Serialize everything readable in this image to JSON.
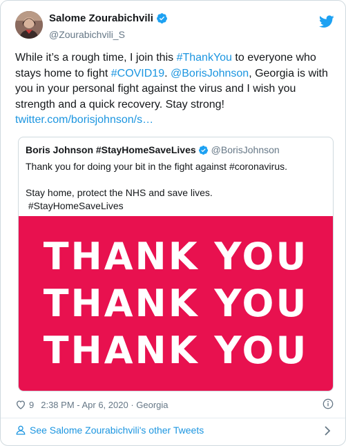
{
  "author": {
    "name": "Salome Zourabichvili",
    "handle": "@Zourabichvili_S"
  },
  "tweet": {
    "t1": "While it’s a rough time, I join this ",
    "hashtag1": "#ThankYou",
    "t2": " to everyone who stays home to fight ",
    "hashtag2": "#COVID19",
    "t3": ". ",
    "mention": "@BorisJohnson",
    "t4": ", Georgia is with you in your personal fight against the virus and I wish you strength and a quick recovery. Stay strong!",
    "link": "twitter.com/borisjohnson/s…"
  },
  "quoted": {
    "name": "Boris Johnson #StayHomeSaveLives",
    "handle": "@BorisJohnson",
    "line1": "Thank you for doing your bit in the fight against #coronavirus.",
    "line2": "Stay home, protect the NHS and save lives.",
    "line3": " #StayHomeSaveLives",
    "image_lines": [
      "THANK YOU",
      "THANK YOU",
      "THANK YOU"
    ],
    "image_bg": "#e8114f"
  },
  "meta": {
    "likes": "9",
    "time": "2:38 PM - Apr 6, 2020",
    "separator": " · ",
    "location": "Georgia"
  },
  "footer": {
    "label": "See Salome Zourabichvili's other Tweets"
  },
  "icons": {
    "verified": "verified-badge-icon",
    "twitter": "twitter-bird-icon",
    "heart": "heart-icon",
    "info": "info-icon",
    "person": "person-icon",
    "chevron": "chevron-right-icon"
  },
  "colors": {
    "link": "#1b95e0",
    "secondary": "#657786",
    "accent": "#1da1f2"
  }
}
